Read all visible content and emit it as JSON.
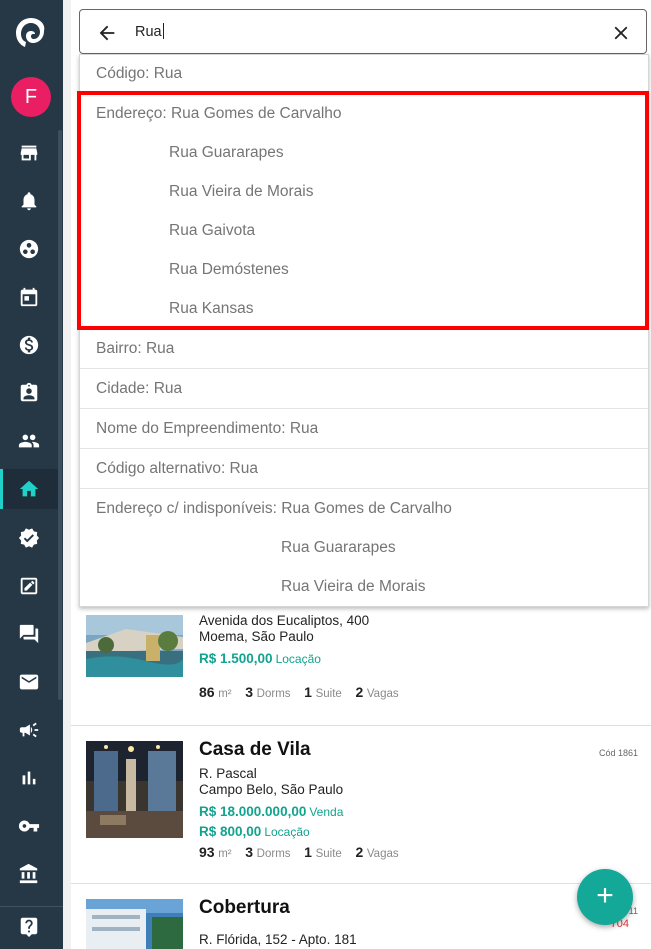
{
  "sidebar": {
    "avatar_letter": "F",
    "items": [
      {
        "icon": "storefront-icon"
      },
      {
        "icon": "bell-icon"
      },
      {
        "icon": "people-network-icon"
      },
      {
        "icon": "calendar-icon"
      },
      {
        "icon": "dollar-icon"
      },
      {
        "icon": "clipboard-user-icon"
      },
      {
        "icon": "group-icon"
      },
      {
        "icon": "home-icon",
        "active": true
      },
      {
        "icon": "verified-badge-icon"
      },
      {
        "icon": "edit-note-icon"
      },
      {
        "icon": "chat-icon"
      },
      {
        "icon": "mail-icon"
      },
      {
        "icon": "megaphone-icon"
      },
      {
        "icon": "bar-chart-icon"
      },
      {
        "icon": "key-icon"
      },
      {
        "icon": "bank-icon"
      },
      {
        "icon": "help-icon"
      }
    ],
    "accent": "#1fd1c9"
  },
  "search": {
    "value": "Rua"
  },
  "dropdown": {
    "codigo": "Código: Rua",
    "endereco": {
      "prefix": "Endereço: ",
      "items": [
        "Rua Gomes de Carvalho",
        "Rua Guararapes",
        "Rua Vieira de Morais",
        "Rua Gaivota",
        "Rua Demóstenes",
        "Rua Kansas"
      ]
    },
    "bairro": "Bairro: Rua",
    "cidade": "Cidade: Rua",
    "empreendimento": "Nome do Empreendimento: Rua",
    "alternativo": "Código alternativo: Rua",
    "endereco_indisp": {
      "prefix": "Endereço c/ indisponíveis: ",
      "items": [
        "Rua Gomes de Carvalho",
        "Rua Guararapes",
        "Rua Vieira de Morais"
      ]
    },
    "highlight_color": "#ff0000"
  },
  "listings": [
    {
      "address": "Avenida dos Eucaliptos, 400",
      "location": "Moema, São Paulo",
      "prices": [
        {
          "value": "R$ 1.500,00",
          "type": "Locação"
        }
      ],
      "specs": {
        "area": "86",
        "area_unit": "m²",
        "dorms": "3",
        "dorms_label": "Dorms",
        "suite": "1",
        "suite_label": "Suite",
        "vagas": "2",
        "vagas_label": "Vagas"
      }
    },
    {
      "title": "Casa de Vila",
      "code": "Cód 1861",
      "address": "R. Pascal",
      "location": "Campo Belo, São Paulo",
      "prices": [
        {
          "value": "R$ 18.000.000,00",
          "type": "Venda"
        },
        {
          "value": "R$ 800,00",
          "type": "Locação"
        }
      ],
      "specs": {
        "area": "93",
        "area_unit": "m²",
        "dorms": "3",
        "dorms_label": "Dorms",
        "suite": "1",
        "suite_label": "Suite",
        "vagas": "2",
        "vagas_label": "Vagas"
      }
    },
    {
      "title": "Cobertura",
      "code_partial": "11",
      "code_red": "704",
      "address": "R. Flórida, 152 - Apto. 181"
    }
  ],
  "fab_label": "+"
}
